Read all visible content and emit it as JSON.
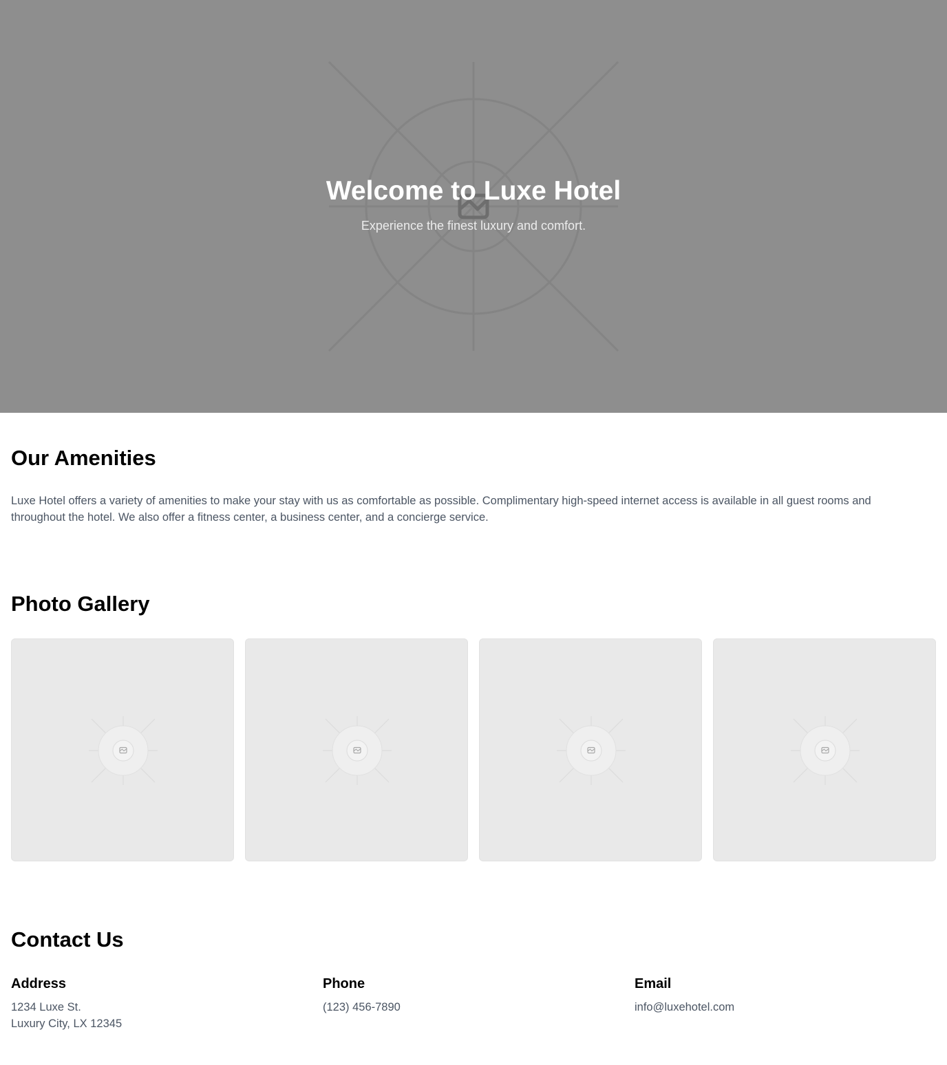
{
  "hero": {
    "title": "Welcome to Luxe Hotel",
    "subtitle": "Experience the finest luxury and comfort.",
    "image_icon": "image-placeholder-icon",
    "background_color": "#8e8e8e"
  },
  "amenities": {
    "heading": "Our Amenities",
    "text": "Luxe Hotel offers a variety of amenities to make your stay with us as comfortable as possible. Complimentary high-speed internet access is available in all guest rooms and throughout the hotel. We also offer a fitness center, a business center, and a concierge service."
  },
  "gallery": {
    "heading": "Photo Gallery",
    "tiles": [
      {
        "icon": "image-placeholder-icon"
      },
      {
        "icon": "image-placeholder-icon"
      },
      {
        "icon": "image-placeholder-icon"
      },
      {
        "icon": "image-placeholder-icon"
      }
    ]
  },
  "contact": {
    "heading": "Contact Us",
    "address": {
      "label": "Address",
      "lines": [
        "1234 Luxe St.",
        "Luxury City, LX 12345"
      ]
    },
    "phone": {
      "label": "Phone",
      "value": "(123) 456-7890"
    },
    "email": {
      "label": "Email",
      "value": "info@luxehotel.com"
    }
  },
  "colors": {
    "body_text": "#4b5563",
    "heading_text": "#000000",
    "tile_background": "#e9e9e9"
  }
}
